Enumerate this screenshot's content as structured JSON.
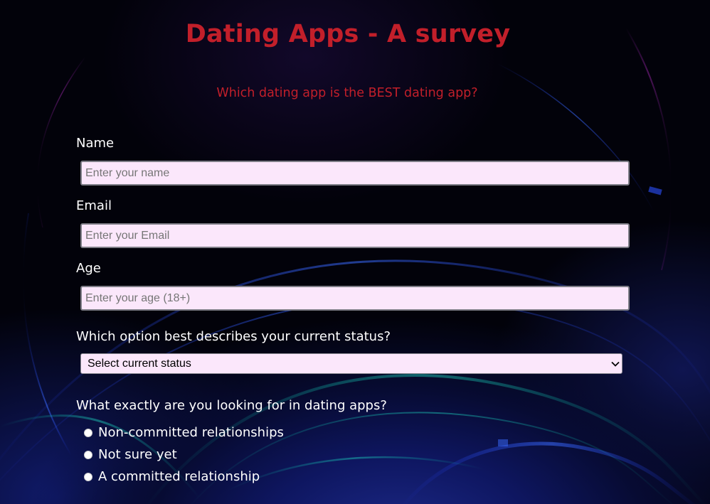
{
  "header": {
    "title": "Dating Apps - A survey",
    "subtitle": "Which dating app is the BEST dating app?"
  },
  "form": {
    "name": {
      "label": "Name",
      "placeholder": "Enter your name",
      "value": ""
    },
    "email": {
      "label": "Email",
      "placeholder": "Enter your Email",
      "value": ""
    },
    "age": {
      "label": "Age",
      "placeholder": "Enter your age (18+)",
      "value": ""
    },
    "status": {
      "question": "Which option best describes your current status?",
      "selected": "Select current status",
      "icon": "chevron-down-icon"
    },
    "looking_for": {
      "question": "What exactly are you looking for in dating apps?",
      "options": [
        {
          "label": "Non-committed relationships",
          "checked": false
        },
        {
          "label": "Not sure yet",
          "checked": false
        },
        {
          "label": "A committed relationship",
          "checked": false
        }
      ]
    }
  },
  "colors": {
    "heading": "#c21f2a",
    "input_bg": "#fbe7fb",
    "text": "#ffffff",
    "background": "#02020a"
  }
}
